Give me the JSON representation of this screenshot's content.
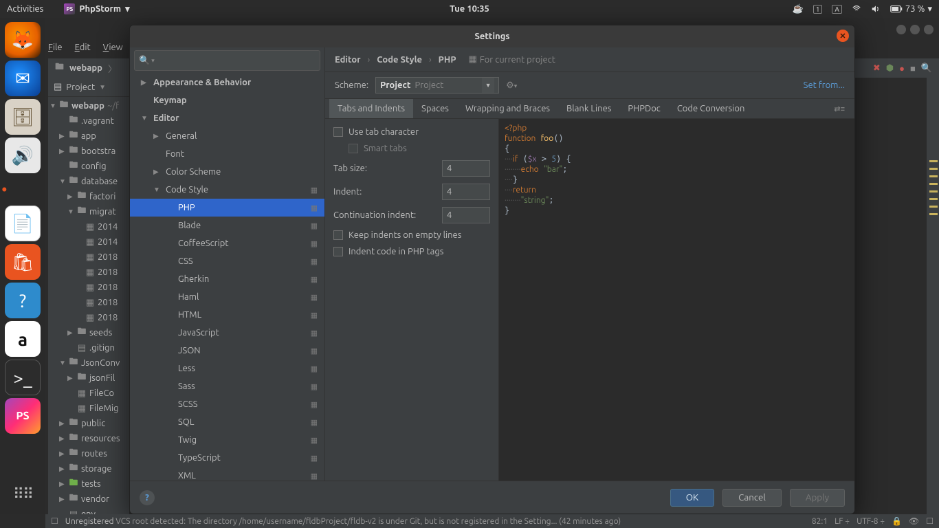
{
  "topbar": {
    "activities": "Activities",
    "app_name": "PhpStorm",
    "clock": "Tue 10:35",
    "battery": "73 %"
  },
  "menubar": [
    "File",
    "Edit",
    "View"
  ],
  "breadcrumb": {
    "project": "webapp"
  },
  "project_panel": {
    "title": "Project",
    "root": "webapp",
    "root_path": "~/f",
    "nodes": [
      {
        "d": 1,
        "icon": "folder",
        "label": ".vagrant"
      },
      {
        "d": 1,
        "icon": "folder",
        "label": "app",
        "exp": true
      },
      {
        "d": 1,
        "icon": "folder",
        "label": "bootstra",
        "exp": true
      },
      {
        "d": 1,
        "icon": "folder",
        "label": "config"
      },
      {
        "d": 1,
        "icon": "folder",
        "label": "database",
        "exp": false,
        "open": true
      },
      {
        "d": 2,
        "icon": "folder",
        "label": "factori",
        "exp": true
      },
      {
        "d": 2,
        "icon": "folder",
        "label": "migrat",
        "exp": true,
        "open": true
      },
      {
        "d": 3,
        "icon": "file-php",
        "label": "2014"
      },
      {
        "d": 3,
        "icon": "file-php",
        "label": "2014"
      },
      {
        "d": 3,
        "icon": "file-php",
        "label": "2018"
      },
      {
        "d": 3,
        "icon": "file-php",
        "label": "2018"
      },
      {
        "d": 3,
        "icon": "file-php",
        "label": "2018"
      },
      {
        "d": 3,
        "icon": "file-php",
        "label": "2018"
      },
      {
        "d": 3,
        "icon": "file-php",
        "label": "2018"
      },
      {
        "d": 2,
        "icon": "folder",
        "label": "seeds",
        "exp": true
      },
      {
        "d": 2,
        "icon": "file",
        "label": ".gitign"
      },
      {
        "d": 1,
        "icon": "folder",
        "label": "JsonConv",
        "exp": true,
        "open": true
      },
      {
        "d": 2,
        "icon": "folder",
        "label": "jsonFil",
        "exp": true
      },
      {
        "d": 2,
        "icon": "file-php",
        "label": "FileCo"
      },
      {
        "d": 2,
        "icon": "file-php",
        "label": "FileMig"
      },
      {
        "d": 1,
        "icon": "folder",
        "label": "public",
        "exp": true
      },
      {
        "d": 1,
        "icon": "folder",
        "label": "resources",
        "exp": true
      },
      {
        "d": 1,
        "icon": "folder",
        "label": "routes",
        "exp": true
      },
      {
        "d": 1,
        "icon": "folder",
        "label": "storage",
        "exp": true
      },
      {
        "d": 1,
        "icon": "folder-green",
        "label": "tests",
        "exp": true
      },
      {
        "d": 1,
        "icon": "folder",
        "label": "vendor",
        "exp": true
      },
      {
        "d": 1,
        "icon": "file",
        "label": "env"
      }
    ]
  },
  "dialog": {
    "title": "Settings",
    "search_placeholder": "",
    "nav": [
      {
        "label": "Appearance & Behavior",
        "bold": true,
        "arrow": "right"
      },
      {
        "label": "Keymap",
        "bold": true
      },
      {
        "label": "Editor",
        "bold": true,
        "arrow": "down"
      },
      {
        "label": "General",
        "sub": 1,
        "arrow": "right"
      },
      {
        "label": "Font",
        "sub": 1
      },
      {
        "label": "Color Scheme",
        "sub": 1,
        "arrow": "right"
      },
      {
        "label": "Code Style",
        "sub": 1,
        "arrow": "down",
        "proj": true
      },
      {
        "label": "PHP",
        "sub": 2,
        "sel": true,
        "proj": true
      },
      {
        "label": "Blade",
        "sub": 2,
        "proj": true
      },
      {
        "label": "CoffeeScript",
        "sub": 2,
        "proj": true
      },
      {
        "label": "CSS",
        "sub": 2,
        "proj": true
      },
      {
        "label": "Gherkin",
        "sub": 2,
        "proj": true
      },
      {
        "label": "Haml",
        "sub": 2,
        "proj": true
      },
      {
        "label": "HTML",
        "sub": 2,
        "proj": true
      },
      {
        "label": "JavaScript",
        "sub": 2,
        "proj": true
      },
      {
        "label": "JSON",
        "sub": 2,
        "proj": true
      },
      {
        "label": "Less",
        "sub": 2,
        "proj": true
      },
      {
        "label": "Sass",
        "sub": 2,
        "proj": true
      },
      {
        "label": "SCSS",
        "sub": 2,
        "proj": true
      },
      {
        "label": "SQL",
        "sub": 2,
        "proj": true
      },
      {
        "label": "Twig",
        "sub": 2,
        "proj": true
      },
      {
        "label": "TypeScript",
        "sub": 2,
        "proj": true
      },
      {
        "label": "XML",
        "sub": 2,
        "proj": true
      }
    ],
    "crumbs": [
      "Editor",
      "Code Style",
      "PHP"
    ],
    "for_project": "For current project",
    "scheme_label": "Scheme:",
    "scheme_value": "Project",
    "scheme_hint": "Project",
    "set_from": "Set from...",
    "tabs": [
      "Tabs and Indents",
      "Spaces",
      "Wrapping and Braces",
      "Blank Lines",
      "PHPDoc",
      "Code Conversion"
    ],
    "form": {
      "use_tab": "Use tab character",
      "smart_tabs": "Smart tabs",
      "tab_size_label": "Tab size:",
      "tab_size": "4",
      "indent_label": "Indent:",
      "indent": "4",
      "cont_label": "Continuation indent:",
      "cont": "4",
      "keep_empty": "Keep indents on empty lines",
      "indent_php": "Indent code in PHP tags"
    },
    "buttons": {
      "ok": "OK",
      "cancel": "Cancel",
      "apply": "Apply"
    }
  },
  "statusbar": {
    "msg_prefix": "Unregistered",
    "msg": "VCS root detected: The directory /home/username/fldbProject/fldb-v2 is under Git, but is not registered in the Setting... (42 minutes ago)",
    "pos": "82:1",
    "lf": "LF",
    "enc": "UTF-8"
  }
}
